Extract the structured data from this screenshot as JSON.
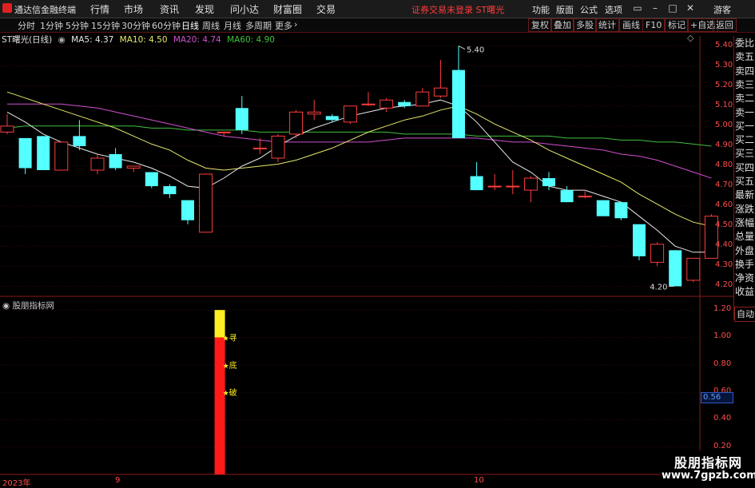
{
  "menubar": {
    "app_title": "通达信金融终端",
    "items": [
      "行情",
      "市场",
      "资讯",
      "发现",
      "问小达",
      "财富圈",
      "交易"
    ],
    "status_text": "证券交易未登录  ST曙光",
    "right_items": [
      "功能",
      "版面",
      "公式",
      "选项"
    ],
    "guest": "游客"
  },
  "period_tabs": [
    "分时",
    "1分钟",
    "5分钟",
    "15分钟",
    "30分钟",
    "60分钟",
    "日线",
    "周线",
    "月线",
    "多周期",
    "更多"
  ],
  "active_period": "日线",
  "right_tabs": [
    "复权",
    "叠加",
    "多股",
    "统计",
    "画线",
    "F10",
    "标记",
    "+自选",
    "返回"
  ],
  "legend": {
    "stock": "ST曙光(日线)",
    "ma5": "MA5: 4.37",
    "ma10": "MA10: 4.50",
    "ma20": "MA20: 4.74",
    "ma60": "MA60: 4.90"
  },
  "indicator_title": "股朋指标网",
  "right_panel": [
    "委比",
    "卖五",
    "卖四",
    "卖三",
    "卖二",
    "卖一",
    "买一",
    "买二",
    "买三",
    "买四",
    "买五",
    "最新",
    "涨跌",
    "涨幅",
    "总量",
    "外盘",
    "换手",
    "净资",
    "收益"
  ],
  "auto_label": "自动",
  "price_axis": [
    "5.40",
    "5.30",
    "5.20",
    "5.10",
    "5.00",
    "4.90",
    "4.80",
    "4.70",
    "4.60",
    "4.50",
    "4.40",
    "4.30",
    "4.20"
  ],
  "indicator_axis": [
    "1.20",
    "1.00",
    "0.80",
    "0.60",
    "0.40",
    "0.20"
  ],
  "current_indicator": "0.56",
  "date_labels": [
    "2023年",
    "9",
    "10"
  ],
  "annotations": {
    "high": "5.40",
    "low": "4.20"
  },
  "signal_labels": [
    "寻",
    "底",
    "破"
  ],
  "watermark": {
    "line1": "股朋指标网",
    "line2": "www.7gpzb.com"
  },
  "colors": {
    "up": "#ff3c3c",
    "down": "#54ffff",
    "ma5": "#e8e8e8",
    "ma10": "#e8e86a",
    "ma20": "#d050d0",
    "ma60": "#40c040",
    "axis": "#ff4d4d"
  },
  "chart_data": {
    "type": "candlestick",
    "ylim": [
      4.15,
      5.45
    ],
    "candles": [
      {
        "o": 4.97,
        "h": 5.06,
        "l": 4.96,
        "c": 5.0
      },
      {
        "o": 4.94,
        "h": 4.94,
        "l": 4.76,
        "c": 4.79
      },
      {
        "o": 4.95,
        "h": 4.95,
        "l": 4.78,
        "c": 4.78
      },
      {
        "o": 4.78,
        "h": 4.92,
        "l": 4.78,
        "c": 4.92
      },
      {
        "o": 4.95,
        "h": 5.03,
        "l": 4.88,
        "c": 4.9
      },
      {
        "o": 4.78,
        "h": 4.86,
        "l": 4.76,
        "c": 4.84
      },
      {
        "o": 4.86,
        "h": 4.89,
        "l": 4.78,
        "c": 4.79
      },
      {
        "o": 4.79,
        "h": 4.8,
        "l": 4.77,
        "c": 4.8
      },
      {
        "o": 4.77,
        "h": 4.77,
        "l": 4.69,
        "c": 4.7
      },
      {
        "o": 4.7,
        "h": 4.71,
        "l": 4.64,
        "c": 4.66
      },
      {
        "o": 4.63,
        "h": 4.63,
        "l": 4.51,
        "c": 4.53
      },
      {
        "o": 4.47,
        "h": 4.76,
        "l": 4.47,
        "c": 4.76
      },
      {
        "o": 4.97,
        "h": 4.97,
        "l": 4.95,
        "c": 4.97
      },
      {
        "o": 5.09,
        "h": 5.15,
        "l": 4.96,
        "c": 4.98
      },
      {
        "o": 4.89,
        "h": 4.94,
        "l": 4.86,
        "c": 4.89
      },
      {
        "o": 4.84,
        "h": 4.96,
        "l": 4.82,
        "c": 4.95
      },
      {
        "o": 4.96,
        "h": 5.08,
        "l": 4.94,
        "c": 5.07
      },
      {
        "o": 5.06,
        "h": 5.13,
        "l": 5.03,
        "c": 5.07
      },
      {
        "o": 5.05,
        "h": 5.06,
        "l": 5.02,
        "c": 5.03
      },
      {
        "o": 5.02,
        "h": 5.1,
        "l": 5.01,
        "c": 5.1
      },
      {
        "o": 5.11,
        "h": 5.17,
        "l": 5.1,
        "c": 5.11
      },
      {
        "o": 5.09,
        "h": 5.14,
        "l": 5.07,
        "c": 5.13
      },
      {
        "o": 5.12,
        "h": 5.13,
        "l": 5.09,
        "c": 5.1
      },
      {
        "o": 5.1,
        "h": 5.19,
        "l": 5.1,
        "c": 5.17
      },
      {
        "o": 5.15,
        "h": 5.33,
        "l": 5.14,
        "c": 5.19
      },
      {
        "o": 5.28,
        "h": 5.4,
        "l": 4.94,
        "c": 4.94
      },
      {
        "o": 4.75,
        "h": 4.82,
        "l": 4.68,
        "c": 4.68
      },
      {
        "o": 4.7,
        "h": 4.76,
        "l": 4.68,
        "c": 4.7
      },
      {
        "o": 4.7,
        "h": 4.78,
        "l": 4.66,
        "c": 4.7
      },
      {
        "o": 4.68,
        "h": 4.75,
        "l": 4.62,
        "c": 4.74
      },
      {
        "o": 4.74,
        "h": 4.77,
        "l": 4.68,
        "c": 4.7
      },
      {
        "o": 4.68,
        "h": 4.7,
        "l": 4.62,
        "c": 4.62
      },
      {
        "o": 4.65,
        "h": 4.68,
        "l": 4.64,
        "c": 4.65
      },
      {
        "o": 4.63,
        "h": 4.63,
        "l": 4.55,
        "c": 4.55
      },
      {
        "o": 4.62,
        "h": 4.62,
        "l": 4.53,
        "c": 4.54
      },
      {
        "o": 4.51,
        "h": 4.51,
        "l": 4.33,
        "c": 4.35
      },
      {
        "o": 4.32,
        "h": 4.42,
        "l": 4.3,
        "c": 4.41
      },
      {
        "o": 4.38,
        "h": 4.38,
        "l": 4.2,
        "c": 4.2
      },
      {
        "o": 4.23,
        "h": 4.34,
        "l": 4.22,
        "c": 4.34
      },
      {
        "o": 4.34,
        "h": 4.56,
        "l": 4.34,
        "c": 4.55
      }
    ],
    "ma5": [
      5.07,
      5.02,
      4.96,
      4.92,
      4.89,
      4.86,
      4.84,
      4.82,
      4.79,
      4.75,
      4.7,
      4.69,
      4.74,
      4.8,
      4.84,
      4.9,
      4.95,
      4.99,
      5.02,
      5.05,
      5.07,
      5.09,
      5.1,
      5.11,
      5.13,
      5.1,
      5.02,
      4.92,
      4.82,
      4.77,
      4.7,
      4.68,
      4.68,
      4.65,
      4.62,
      4.55,
      4.48,
      4.4,
      4.37,
      4.37
    ],
    "ma10": [
      5.17,
      5.14,
      5.11,
      5.08,
      5.05,
      5.02,
      4.99,
      4.95,
      4.91,
      4.88,
      4.83,
      4.79,
      4.78,
      4.79,
      4.8,
      4.81,
      4.83,
      4.86,
      4.89,
      4.93,
      4.97,
      5.0,
      5.03,
      5.05,
      5.08,
      5.1,
      5.06,
      5.01,
      4.97,
      4.93,
      4.88,
      4.84,
      4.8,
      4.76,
      4.72,
      4.66,
      4.61,
      4.56,
      4.52,
      4.5
    ],
    "ma20": [
      5.11,
      5.11,
      5.11,
      5.11,
      5.1,
      5.09,
      5.07,
      5.05,
      5.03,
      5.01,
      4.99,
      4.97,
      4.95,
      4.94,
      4.93,
      4.92,
      4.92,
      4.92,
      4.92,
      4.92,
      4.92,
      4.93,
      4.94,
      4.94,
      4.94,
      4.94,
      4.94,
      4.93,
      4.92,
      4.92,
      4.91,
      4.9,
      4.89,
      4.88,
      4.86,
      4.85,
      4.83,
      4.8,
      4.77,
      4.74
    ],
    "ma60": [
      4.99,
      5.0,
      5.0,
      5.0,
      5.0,
      5.0,
      5.0,
      5.0,
      4.99,
      4.99,
      4.98,
      4.98,
      4.98,
      4.98,
      4.97,
      4.97,
      4.97,
      4.97,
      4.97,
      4.97,
      4.97,
      4.97,
      4.96,
      4.96,
      4.96,
      4.96,
      4.95,
      4.95,
      4.95,
      4.95,
      4.95,
      4.94,
      4.94,
      4.94,
      4.93,
      4.93,
      4.92,
      4.92,
      4.91,
      4.9
    ],
    "indicator": {
      "ylim": [
        0,
        1.3
      ],
      "bar_index": 11,
      "yellow_from": 1.0,
      "yellow_to": 1.2,
      "red_from": 0,
      "red_to": 1.0,
      "signals": [
        {
          "label": "寻",
          "y": 1.0
        },
        {
          "label": "底",
          "y": 0.8
        },
        {
          "label": "破",
          "y": 0.6
        }
      ]
    }
  }
}
